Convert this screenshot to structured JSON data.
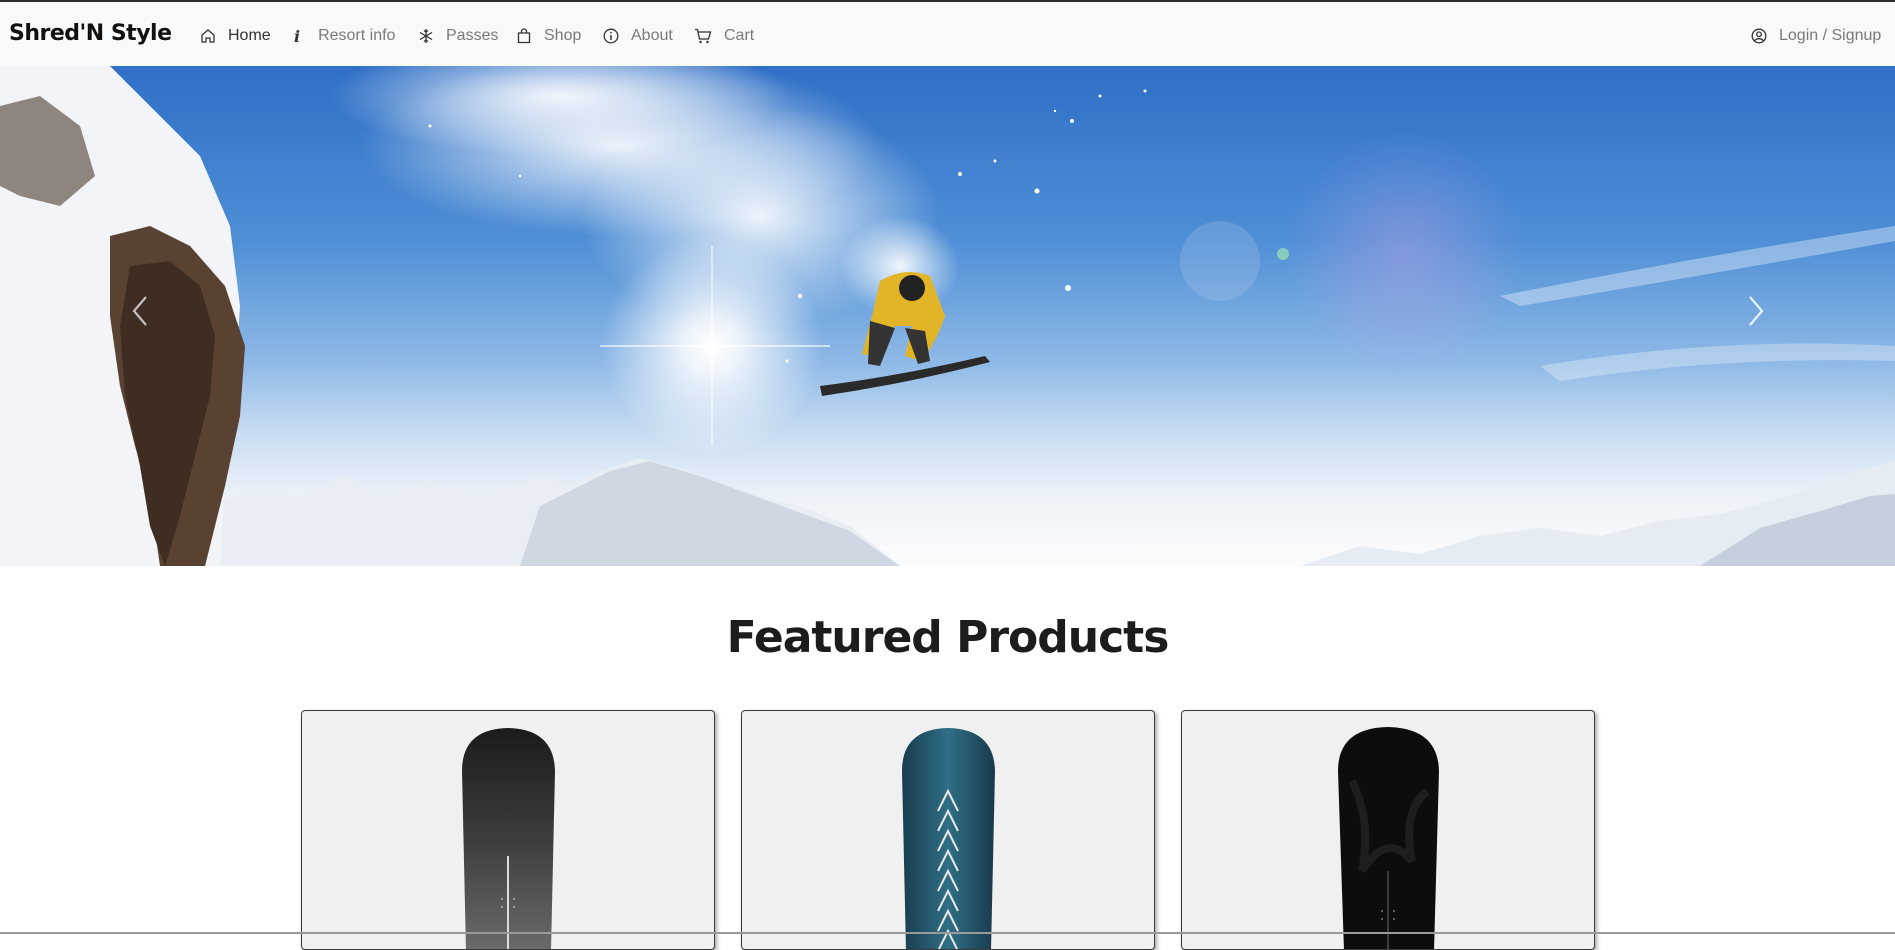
{
  "brand": "Shred'N Style",
  "nav": {
    "items": [
      {
        "label": "Home",
        "icon": "home-icon"
      },
      {
        "label": "Resort info",
        "icon": "info-icon"
      },
      {
        "label": "Passes",
        "icon": "snowflake-icon"
      },
      {
        "label": "Shop",
        "icon": "shopping-bag-icon"
      },
      {
        "label": "About",
        "icon": "info-circle-icon"
      },
      {
        "label": "Cart",
        "icon": "cart-icon"
      }
    ],
    "login": {
      "label": "Login / Signup",
      "icon": "user-circle-icon"
    }
  },
  "hero": {
    "prev_icon": "chevron-left-icon",
    "next_icon": "chevron-right-icon"
  },
  "featured": {
    "title": "Featured Products",
    "products": [
      {
        "image": "snowboard-dark-grey"
      },
      {
        "image": "snowboard-teal-arrows"
      },
      {
        "image": "snowboard-black"
      }
    ]
  },
  "colors": {
    "navbar_bg": "#f8f9fa",
    "card_bg": "#f0f0f0",
    "sky": "#3a7bd5"
  }
}
